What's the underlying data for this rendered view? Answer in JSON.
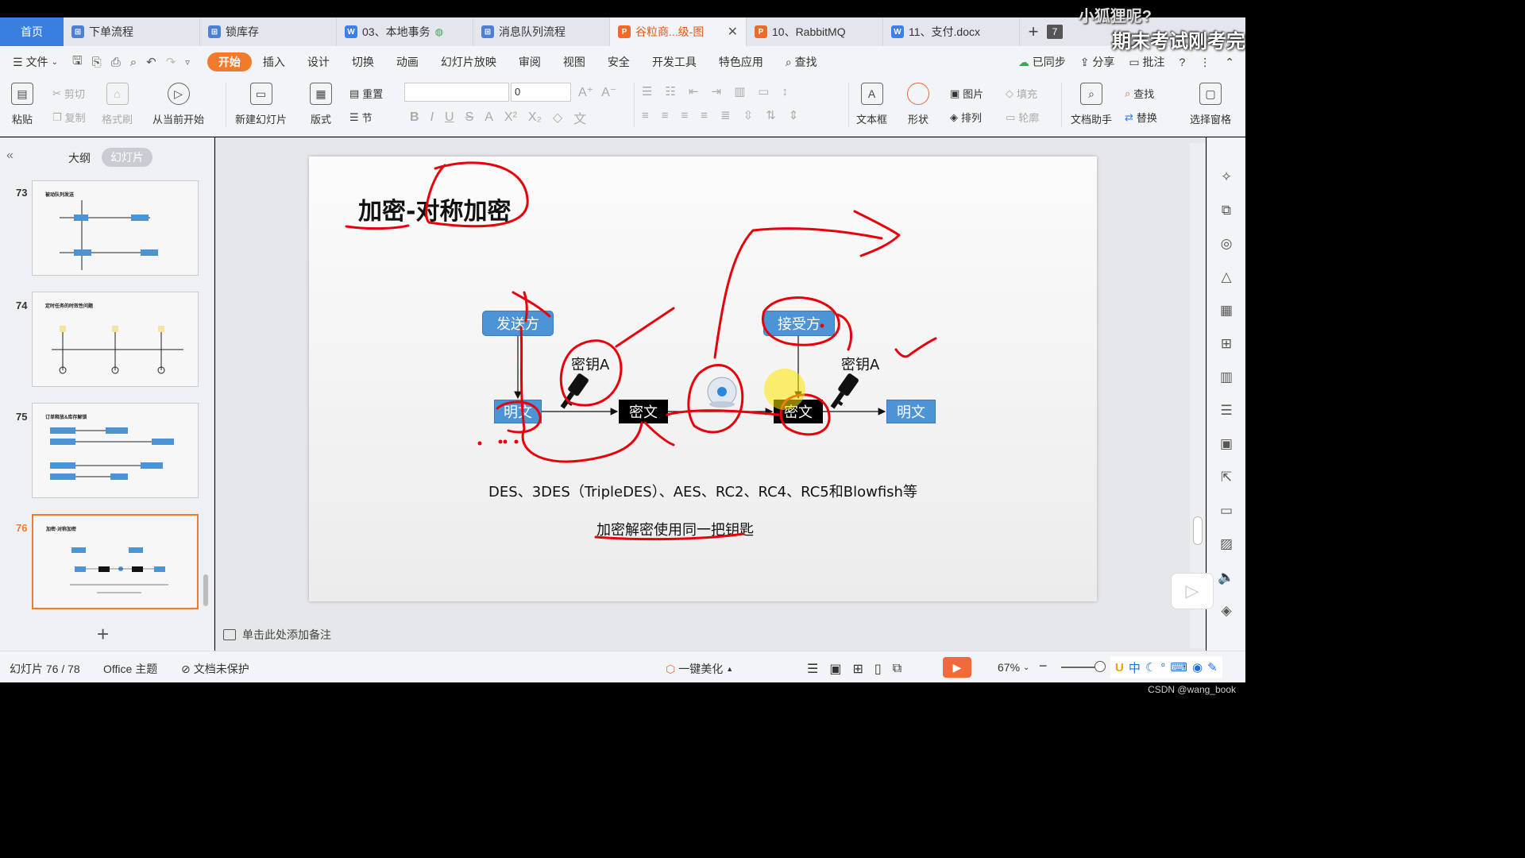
{
  "watermark": {
    "line1": "小狐狸呢?",
    "line2": "期末考试刚考完"
  },
  "tabs": [
    {
      "label": "首页",
      "kind": "home"
    },
    {
      "label": "下单流程",
      "kind": "flow"
    },
    {
      "label": "锁库存",
      "kind": "flow"
    },
    {
      "label": "03、本地事务",
      "kind": "doc"
    },
    {
      "label": "消息队列流程",
      "kind": "flow"
    },
    {
      "label": "谷粒商...级-图",
      "kind": "ppt",
      "active": true
    },
    {
      "label": "10、RabbitMQ",
      "kind": "ppt"
    },
    {
      "label": "11、支付.docx",
      "kind": "doc"
    }
  ],
  "tab_count": "7",
  "menu": {
    "file": "文件",
    "items": [
      "开始",
      "插入",
      "设计",
      "切换",
      "动画",
      "幻灯片放映",
      "审阅",
      "视图",
      "安全",
      "开发工具",
      "特色应用"
    ],
    "search": "查找",
    "sync": "已同步",
    "share": "分享",
    "comment": "批注"
  },
  "ribbon": {
    "paste": "粘贴",
    "cut": "剪切",
    "copy": "复制",
    "format_painter": "格式刷",
    "from_current": "从当前开始",
    "new_slide": "新建幻灯片",
    "layout": "版式",
    "reset": "重置",
    "section": "节",
    "font_size": "0",
    "textbox": "文本框",
    "shape": "形状",
    "picture": "图片",
    "arrange": "排列",
    "fill": "填充",
    "outline": "轮廓",
    "doc_helper": "文档助手",
    "find": "查找",
    "replace": "替换",
    "select_pane": "选择窗格"
  },
  "left_panel": {
    "outline": "大纲",
    "slides": "幻灯片",
    "thumbs": [
      {
        "num": "73",
        "title": "被动队列发送"
      },
      {
        "num": "74",
        "title": "定时任务的时效性问题"
      },
      {
        "num": "75",
        "title": "订单释放&库存解锁"
      },
      {
        "num": "76",
        "title": "加密-对称加密",
        "active": true
      }
    ]
  },
  "slide": {
    "title": "加密-对称加密",
    "sender": "发送方",
    "receiver": "接受方",
    "plaintext_left": "明文",
    "ciphertext_mid": "密文",
    "ciphertext_right": "密文",
    "plaintext_right": "明文",
    "key_left": "密钥A",
    "key_right": "密钥A",
    "algorithms": "DES、3DES（TripleDES）、AES、RC2、RC4、RC5和Blowfish等",
    "note": "加密解密使用同一把钥匙"
  },
  "notes_placeholder": "单击此处添加备注",
  "status": {
    "slide_pos": "幻灯片 76 / 78",
    "theme": "Office 主题",
    "protect": "文档未保护",
    "beautify": "一键美化",
    "zoom": "67%"
  },
  "ime": {
    "lang": "中"
  },
  "csdn": "CSDN @wang_book",
  "colors": {
    "accent": "#f07b2c",
    "tab_home": "#3a7fe0",
    "box_blue": "#4c94d6",
    "ink": "#e8000b"
  }
}
